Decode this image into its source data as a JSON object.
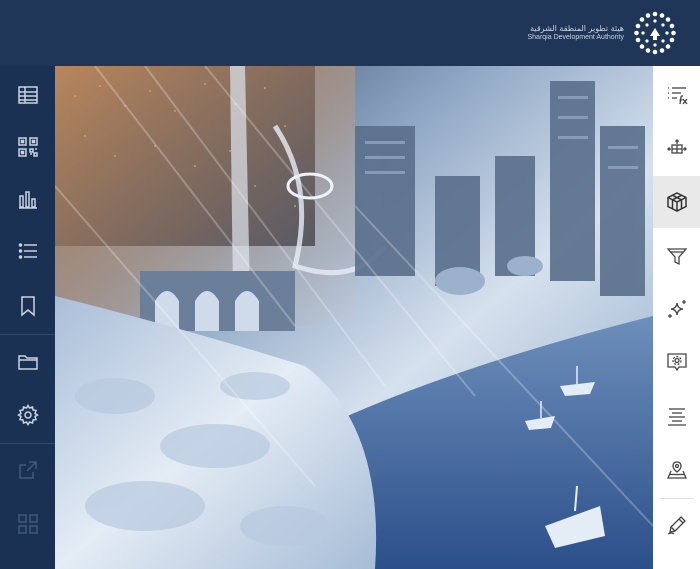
{
  "header": {
    "logo_text_ar": "هيئة تطوير المنطقة الشرقية",
    "logo_text_en": "Sharqia Development Authority",
    "logo_icon": "sda-logo-icon"
  },
  "left_toolbar": {
    "items": [
      {
        "icon": "table-icon"
      },
      {
        "icon": "qr-code-icon"
      },
      {
        "icon": "bar-chart-icon"
      },
      {
        "icon": "list-icon"
      },
      {
        "icon": "bookmark-icon"
      },
      {
        "icon": "folder-icon"
      },
      {
        "icon": "settings-gear-icon"
      },
      {
        "icon": "share-export-icon",
        "disabled": true
      },
      {
        "icon": "grid-widgets-icon",
        "disabled": true
      }
    ]
  },
  "right_toolbar": {
    "active_index": 2,
    "items": [
      {
        "icon": "list-function-icon"
      },
      {
        "icon": "layer-arrows-icon"
      },
      {
        "icon": "3d-cube-icon"
      },
      {
        "icon": "filter-funnel-icon"
      },
      {
        "icon": "sparkle-icon"
      },
      {
        "icon": "map-settings-icon"
      },
      {
        "icon": "align-text-icon"
      },
      {
        "icon": "location-landmark-icon"
      },
      {
        "icon": "edit-pen-icon"
      }
    ]
  },
  "colors": {
    "header_bg": "#1f3658",
    "sidebar_bg": "#1b3153",
    "icon_light": "#c9d3e2",
    "icon_dark": "#444444",
    "active_bg": "#e9e9e9"
  }
}
